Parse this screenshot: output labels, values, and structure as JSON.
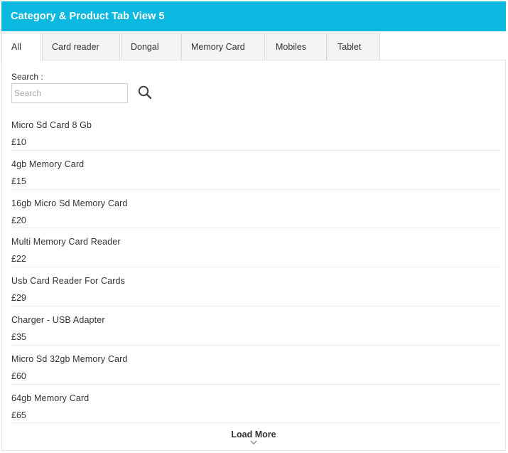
{
  "header": {
    "title": "Category & Product Tab View 5"
  },
  "tabs": [
    {
      "label": "All"
    },
    {
      "label": "Card reader"
    },
    {
      "label": "Dongal"
    },
    {
      "label": "Memory Card"
    },
    {
      "label": "Mobiles"
    },
    {
      "label": "Tablet"
    }
  ],
  "search": {
    "label": "Search :",
    "placeholder": "Search"
  },
  "products": [
    {
      "name": "Micro Sd Card 8 Gb",
      "price": "£10"
    },
    {
      "name": "4gb Memory Card",
      "price": "£15"
    },
    {
      "name": "16gb Micro Sd Memory Card",
      "price": "£20"
    },
    {
      "name": "Multi Memory Card Reader",
      "price": "£22"
    },
    {
      "name": "Usb Card Reader For Cards",
      "price": "£29"
    },
    {
      "name": "Charger - USB Adapter",
      "price": "£35"
    },
    {
      "name": "Micro Sd 32gb Memory Card",
      "price": "£60"
    },
    {
      "name": "64gb Memory Card",
      "price": "£65"
    }
  ],
  "load_more": {
    "label": "Load More"
  },
  "colors": {
    "accent": "#0bb8e0"
  },
  "icons": {
    "search": "search-icon",
    "load_more": "chevron-down-icon"
  }
}
